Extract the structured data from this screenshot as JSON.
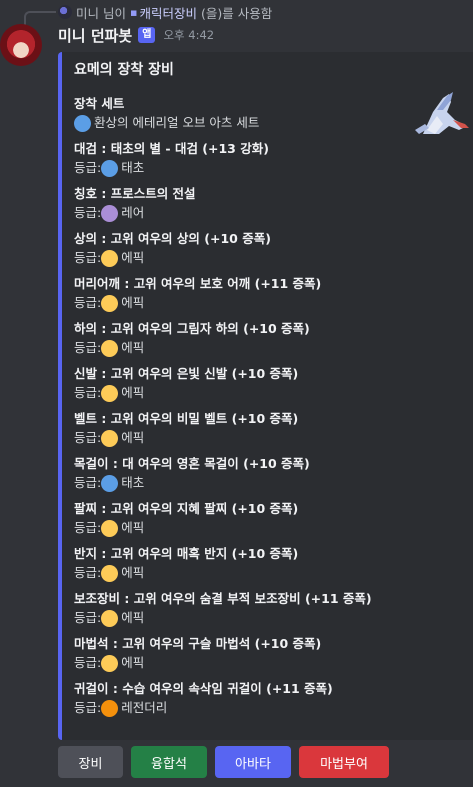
{
  "reply": {
    "user": "미니 님이",
    "command": "캐릭터장비",
    "suffix": "(을)를 사용함"
  },
  "message": {
    "author": "미니 던파봇",
    "badge": "앱",
    "timestamp": "오후 4:42"
  },
  "embed": {
    "title": "요메의 장착 장비",
    "color": "#5865f2",
    "fields": [
      {
        "name": "장착 세트",
        "value": "환상의 에테리얼 오브 아츠 세트",
        "dot": "blue"
      },
      {
        "name": "대검 : 태초의 별 - 대검 (+13 강화)",
        "value": "등급: ",
        "grade": "태초",
        "dot": "blue"
      },
      {
        "name": "칭호 : 프로스트의 전설",
        "value": "등급: ",
        "grade": "레어",
        "dot": "purple"
      },
      {
        "name": "상의 : 고위 여우의 상의 (+10 증폭)",
        "value": "등급: ",
        "grade": "에픽",
        "dot": "yellow"
      },
      {
        "name": "머리어깨 : 고위 여우의 보호 어깨 (+11 증폭)",
        "value": "등급: ",
        "grade": "에픽",
        "dot": "yellow"
      },
      {
        "name": "하의 : 고위 여우의 그림자 하의 (+10 증폭)",
        "value": "등급: ",
        "grade": "에픽",
        "dot": "yellow"
      },
      {
        "name": "신발 : 고위 여우의 은빛 신발 (+10 증폭)",
        "value": "등급: ",
        "grade": "에픽",
        "dot": "yellow"
      },
      {
        "name": "벨트 : 고위 여우의 비밀 벨트 (+10 증폭)",
        "value": "등급: ",
        "grade": "에픽",
        "dot": "yellow"
      },
      {
        "name": "목걸이 : 대 여우의 영혼 목걸이 (+10 증폭)",
        "value": "등급: ",
        "grade": "태초",
        "dot": "blue"
      },
      {
        "name": "팔찌 : 고위 여우의 지혜 팔찌 (+10 증폭)",
        "value": "등급: ",
        "grade": "에픽",
        "dot": "yellow"
      },
      {
        "name": "반지 : 고위 여우의 매혹 반지 (+10 증폭)",
        "value": "등급: ",
        "grade": "에픽",
        "dot": "yellow"
      },
      {
        "name": "보조장비 : 고위 여우의 숨결 부적 보조장비 (+11 증폭)",
        "value": "등급: ",
        "grade": "에픽",
        "dot": "yellow"
      },
      {
        "name": "마법석 : 고위 여우의 구슬 마법석 (+10 증폭)",
        "value": "등급: ",
        "grade": "에픽",
        "dot": "yellow"
      },
      {
        "name": "귀걸이 : 수습 여우의 속삭임 귀걸이 (+11 증폭)",
        "value": "등급: ",
        "grade": "레전더리",
        "dot": "orange"
      }
    ]
  },
  "buttons": [
    {
      "label": "장비",
      "style": "gray"
    },
    {
      "label": "융합석",
      "style": "green"
    },
    {
      "label": "아바타",
      "style": "blurple"
    },
    {
      "label": "마법부여",
      "style": "red"
    }
  ]
}
